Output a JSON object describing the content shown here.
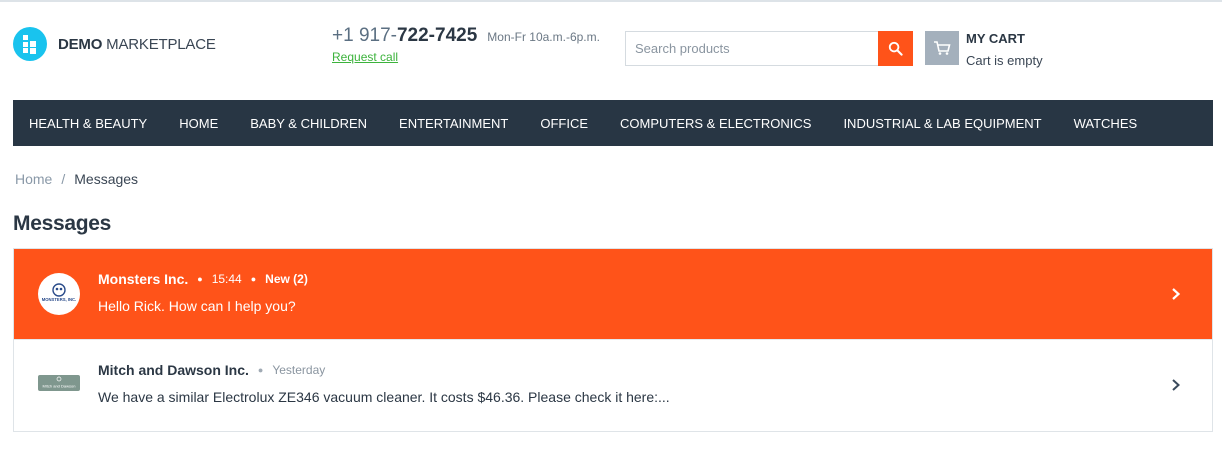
{
  "header": {
    "logo_bold": "DEMO",
    "logo_rest": " MARKETPLACE",
    "phone_prefix": "+1 917-",
    "phone_main": "722-7425",
    "hours": "Mon-Fr 10a.m.-6p.m.",
    "request_call": "Request call",
    "search_placeholder": "Search products",
    "cart_title": "MY CART",
    "cart_status": "Cart is empty"
  },
  "nav": {
    "items": [
      "HEALTH & BEAUTY",
      "HOME",
      "BABY & CHILDREN",
      "ENTERTAINMENT",
      "OFFICE",
      "COMPUTERS & ELECTRONICS",
      "INDUSTRIAL & LAB EQUIPMENT",
      "WATCHES"
    ]
  },
  "breadcrumb": {
    "home": "Home",
    "separator": "/",
    "current": "Messages"
  },
  "page_title": "Messages",
  "messages": [
    {
      "name": "Monsters Inc.",
      "time": "15:44",
      "badge": "New (2)",
      "text": "Hello Rick. How can I help you?",
      "avatar_text": "MONSTERS, INC.",
      "icon": "monsters-inc-logo"
    },
    {
      "name": "Mitch and Dawson Inc.",
      "time": "Yesterday",
      "text": "We have a similar Electrolux ZE346 vacuum cleaner. It costs $46.36. Please check it here:...",
      "avatar_text": "Mitch and Dawson",
      "icon": "mitch-dawson-logo"
    }
  ],
  "colors": {
    "accent": "#ff5319",
    "nav_bg": "#283644",
    "logo": "#19c3ee",
    "request_link": "#3cb33c"
  }
}
